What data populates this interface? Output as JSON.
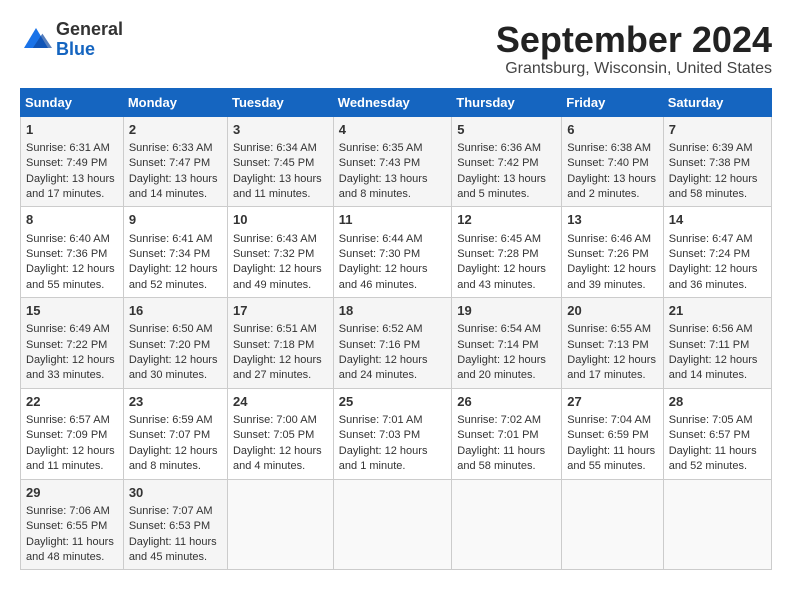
{
  "logo": {
    "line1": "General",
    "line2": "Blue"
  },
  "title": "September 2024",
  "subtitle": "Grantsburg, Wisconsin, United States",
  "days_of_week": [
    "Sunday",
    "Monday",
    "Tuesday",
    "Wednesday",
    "Thursday",
    "Friday",
    "Saturday"
  ],
  "weeks": [
    [
      {
        "day": "1",
        "sunrise": "Sunrise: 6:31 AM",
        "sunset": "Sunset: 7:49 PM",
        "daylight": "Daylight: 13 hours and 17 minutes."
      },
      {
        "day": "2",
        "sunrise": "Sunrise: 6:33 AM",
        "sunset": "Sunset: 7:47 PM",
        "daylight": "Daylight: 13 hours and 14 minutes."
      },
      {
        "day": "3",
        "sunrise": "Sunrise: 6:34 AM",
        "sunset": "Sunset: 7:45 PM",
        "daylight": "Daylight: 13 hours and 11 minutes."
      },
      {
        "day": "4",
        "sunrise": "Sunrise: 6:35 AM",
        "sunset": "Sunset: 7:43 PM",
        "daylight": "Daylight: 13 hours and 8 minutes."
      },
      {
        "day": "5",
        "sunrise": "Sunrise: 6:36 AM",
        "sunset": "Sunset: 7:42 PM",
        "daylight": "Daylight: 13 hours and 5 minutes."
      },
      {
        "day": "6",
        "sunrise": "Sunrise: 6:38 AM",
        "sunset": "Sunset: 7:40 PM",
        "daylight": "Daylight: 13 hours and 2 minutes."
      },
      {
        "day": "7",
        "sunrise": "Sunrise: 6:39 AM",
        "sunset": "Sunset: 7:38 PM",
        "daylight": "Daylight: 12 hours and 58 minutes."
      }
    ],
    [
      {
        "day": "8",
        "sunrise": "Sunrise: 6:40 AM",
        "sunset": "Sunset: 7:36 PM",
        "daylight": "Daylight: 12 hours and 55 minutes."
      },
      {
        "day": "9",
        "sunrise": "Sunrise: 6:41 AM",
        "sunset": "Sunset: 7:34 PM",
        "daylight": "Daylight: 12 hours and 52 minutes."
      },
      {
        "day": "10",
        "sunrise": "Sunrise: 6:43 AM",
        "sunset": "Sunset: 7:32 PM",
        "daylight": "Daylight: 12 hours and 49 minutes."
      },
      {
        "day": "11",
        "sunrise": "Sunrise: 6:44 AM",
        "sunset": "Sunset: 7:30 PM",
        "daylight": "Daylight: 12 hours and 46 minutes."
      },
      {
        "day": "12",
        "sunrise": "Sunrise: 6:45 AM",
        "sunset": "Sunset: 7:28 PM",
        "daylight": "Daylight: 12 hours and 43 minutes."
      },
      {
        "day": "13",
        "sunrise": "Sunrise: 6:46 AM",
        "sunset": "Sunset: 7:26 PM",
        "daylight": "Daylight: 12 hours and 39 minutes."
      },
      {
        "day": "14",
        "sunrise": "Sunrise: 6:47 AM",
        "sunset": "Sunset: 7:24 PM",
        "daylight": "Daylight: 12 hours and 36 minutes."
      }
    ],
    [
      {
        "day": "15",
        "sunrise": "Sunrise: 6:49 AM",
        "sunset": "Sunset: 7:22 PM",
        "daylight": "Daylight: 12 hours and 33 minutes."
      },
      {
        "day": "16",
        "sunrise": "Sunrise: 6:50 AM",
        "sunset": "Sunset: 7:20 PM",
        "daylight": "Daylight: 12 hours and 30 minutes."
      },
      {
        "day": "17",
        "sunrise": "Sunrise: 6:51 AM",
        "sunset": "Sunset: 7:18 PM",
        "daylight": "Daylight: 12 hours and 27 minutes."
      },
      {
        "day": "18",
        "sunrise": "Sunrise: 6:52 AM",
        "sunset": "Sunset: 7:16 PM",
        "daylight": "Daylight: 12 hours and 24 minutes."
      },
      {
        "day": "19",
        "sunrise": "Sunrise: 6:54 AM",
        "sunset": "Sunset: 7:14 PM",
        "daylight": "Daylight: 12 hours and 20 minutes."
      },
      {
        "day": "20",
        "sunrise": "Sunrise: 6:55 AM",
        "sunset": "Sunset: 7:13 PM",
        "daylight": "Daylight: 12 hours and 17 minutes."
      },
      {
        "day": "21",
        "sunrise": "Sunrise: 6:56 AM",
        "sunset": "Sunset: 7:11 PM",
        "daylight": "Daylight: 12 hours and 14 minutes."
      }
    ],
    [
      {
        "day": "22",
        "sunrise": "Sunrise: 6:57 AM",
        "sunset": "Sunset: 7:09 PM",
        "daylight": "Daylight: 12 hours and 11 minutes."
      },
      {
        "day": "23",
        "sunrise": "Sunrise: 6:59 AM",
        "sunset": "Sunset: 7:07 PM",
        "daylight": "Daylight: 12 hours and 8 minutes."
      },
      {
        "day": "24",
        "sunrise": "Sunrise: 7:00 AM",
        "sunset": "Sunset: 7:05 PM",
        "daylight": "Daylight: 12 hours and 4 minutes."
      },
      {
        "day": "25",
        "sunrise": "Sunrise: 7:01 AM",
        "sunset": "Sunset: 7:03 PM",
        "daylight": "Daylight: 12 hours and 1 minute."
      },
      {
        "day": "26",
        "sunrise": "Sunrise: 7:02 AM",
        "sunset": "Sunset: 7:01 PM",
        "daylight": "Daylight: 11 hours and 58 minutes."
      },
      {
        "day": "27",
        "sunrise": "Sunrise: 7:04 AM",
        "sunset": "Sunset: 6:59 PM",
        "daylight": "Daylight: 11 hours and 55 minutes."
      },
      {
        "day": "28",
        "sunrise": "Sunrise: 7:05 AM",
        "sunset": "Sunset: 6:57 PM",
        "daylight": "Daylight: 11 hours and 52 minutes."
      }
    ],
    [
      {
        "day": "29",
        "sunrise": "Sunrise: 7:06 AM",
        "sunset": "Sunset: 6:55 PM",
        "daylight": "Daylight: 11 hours and 48 minutes."
      },
      {
        "day": "30",
        "sunrise": "Sunrise: 7:07 AM",
        "sunset": "Sunset: 6:53 PM",
        "daylight": "Daylight: 11 hours and 45 minutes."
      },
      null,
      null,
      null,
      null,
      null
    ]
  ]
}
